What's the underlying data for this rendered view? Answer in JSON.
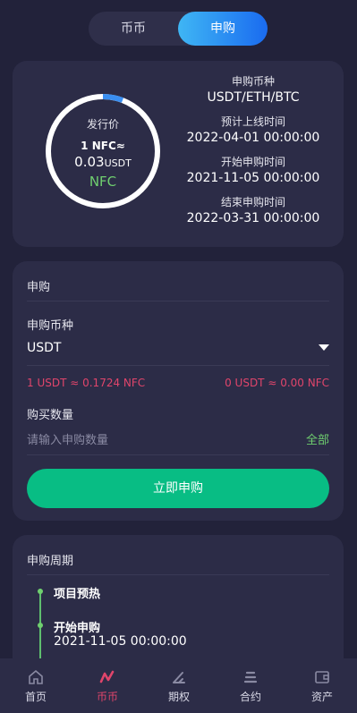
{
  "top_tabs": [
    "币币",
    "申购"
  ],
  "summary": {
    "ring_label": "发行价",
    "ring_line1": "1 NFC≈",
    "ring_amount": "0.03",
    "ring_unit": "USDT",
    "ring_token": "NFC",
    "subscribe_currency_label": "申购币种",
    "subscribe_currency_value": "USDT/ETH/BTC",
    "listing_time_label": "预计上线时间",
    "listing_time_value": "2022-04-01 00:00:00",
    "start_time_label": "开始申购时间",
    "start_time_value": "2021-11-05 00:00:00",
    "end_time_label": "结束申购时间",
    "end_time_value": "2022-03-31 00:00:00"
  },
  "form": {
    "title": "申购",
    "currency_label": "申购币种",
    "currency_value": "USDT",
    "rate_left": "1 USDT ≈ 0.1724 NFC",
    "rate_right": "0 USDT ≈ 0.00 NFC",
    "quantity_label": "购买数量",
    "quantity_placeholder": "请输入申购数量",
    "all_label": "全部",
    "submit_label": "立即申购"
  },
  "period": {
    "title": "申购周期",
    "steps": [
      {
        "title": "项目预热",
        "time": ""
      },
      {
        "title": "开始申购",
        "time": "2021-11-05 00:00:00"
      }
    ]
  },
  "tabbar": {
    "items": [
      {
        "label": "首页",
        "icon": "home-icon"
      },
      {
        "label": "币币",
        "icon": "coin-icon"
      },
      {
        "label": "期权",
        "icon": "options-icon"
      },
      {
        "label": "合约",
        "icon": "contract-icon"
      },
      {
        "label": "资产",
        "icon": "wallet-icon"
      }
    ],
    "active": "币币"
  },
  "colors": {
    "background": "#22223a",
    "card": "#2c2c47",
    "accent_green": "#08bd84",
    "price_green": "#6fcf6f",
    "rate_red": "#e0456b",
    "tab_gradient_start": "#3fb6f4",
    "tab_gradient_end": "#1a6bf0"
  }
}
